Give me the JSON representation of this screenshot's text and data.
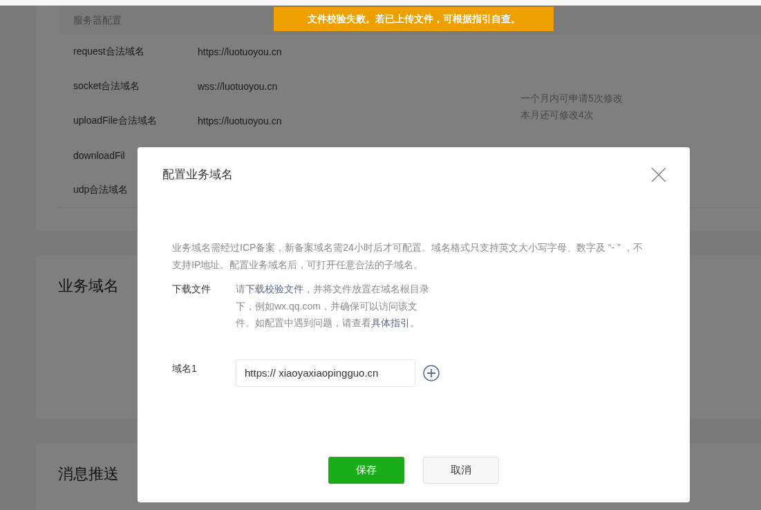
{
  "toast": {
    "text": "文件校验失败。若已上传文件，可根据指引自查。"
  },
  "server_config": {
    "header": "服务器配置",
    "rows": [
      {
        "label": "request合法域名",
        "value": "https://luotuoyou.cn"
      },
      {
        "label": "socket合法域名",
        "value": "wss://luotuoyou.cn"
      },
      {
        "label": "uploadFile合法域名",
        "value": "https://luotuoyou.cn"
      },
      {
        "label": "downloadFil"
      },
      {
        "label": "udp合法域名"
      }
    ],
    "note": [
      "一个月内可申请5次修改",
      "本月还可修改4次"
    ]
  },
  "sections": [
    {
      "title": "业务域名"
    },
    {
      "title": "消息推送"
    }
  ],
  "dialog": {
    "title": "配置业务域名",
    "description": "业务域名需经过ICP备案，新备案域名需24小时后才可配置。域名格式只支持英文大小写字母、数字及 “- ” ，不支持IP地址。配置业务域名后，可打开任意合法的子域名。",
    "fields": [
      {
        "kind": "text",
        "label": "下载文件",
        "parts": [
          {
            "kind": "plain",
            "text": "请"
          },
          {
            "kind": "link",
            "text": "下载校验文件"
          },
          {
            "kind": "plain",
            "text": "，并将文件放置在域名根目录下，例如wx.qq.com，并确保可以访问该文件。如配置中遇到问题，请查看"
          },
          {
            "kind": "link",
            "text": "具体指引。"
          }
        ]
      },
      {
        "kind": "input",
        "label": "域名1",
        "value": "https:// xiaoyaxiaopingguo.cn"
      }
    ],
    "buttons": [
      {
        "kind": "primary",
        "label": "保存"
      },
      {
        "kind": "default",
        "label": "取消"
      }
    ]
  }
}
